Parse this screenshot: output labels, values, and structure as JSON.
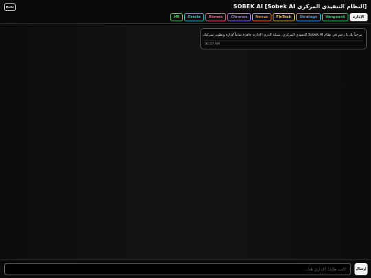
{
  "header": {
    "title": "SOBEK AI [Sobek AI النظام التنفيذي المركزي]",
    "clear_label": "مسح"
  },
  "tabs": [
    {
      "label": "الإدارة",
      "color": "#f2f2f2",
      "active": true
    },
    {
      "label": "Vanguard",
      "color": "#2bd67b"
    },
    {
      "label": "Stratego",
      "color": "#3ba6ff"
    },
    {
      "label": "FinTech",
      "color": "#f5c542"
    },
    {
      "label": "Nexus",
      "color": "#ff8a3d"
    },
    {
      "label": "Chronos",
      "color": "#a27bff"
    },
    {
      "label": "Romeo",
      "color": "#ff5c8a"
    },
    {
      "label": "Oracle",
      "color": "#28c2d6"
    },
    {
      "label": "HR",
      "color": "#5fd35f"
    }
  ],
  "messages": [
    {
      "text": "مرحباً بك يا زعيم في نظام Sobek AI التنفيذي المركزي. شبكة الذرى الإدارية جاهزة تماماً لإدارة وتطوير شركتك.",
      "time": "02:57 AM"
    }
  ],
  "input": {
    "placeholder": "اكتب طلبك الإداري هنا...",
    "value": "",
    "send_label": "إرسال"
  }
}
